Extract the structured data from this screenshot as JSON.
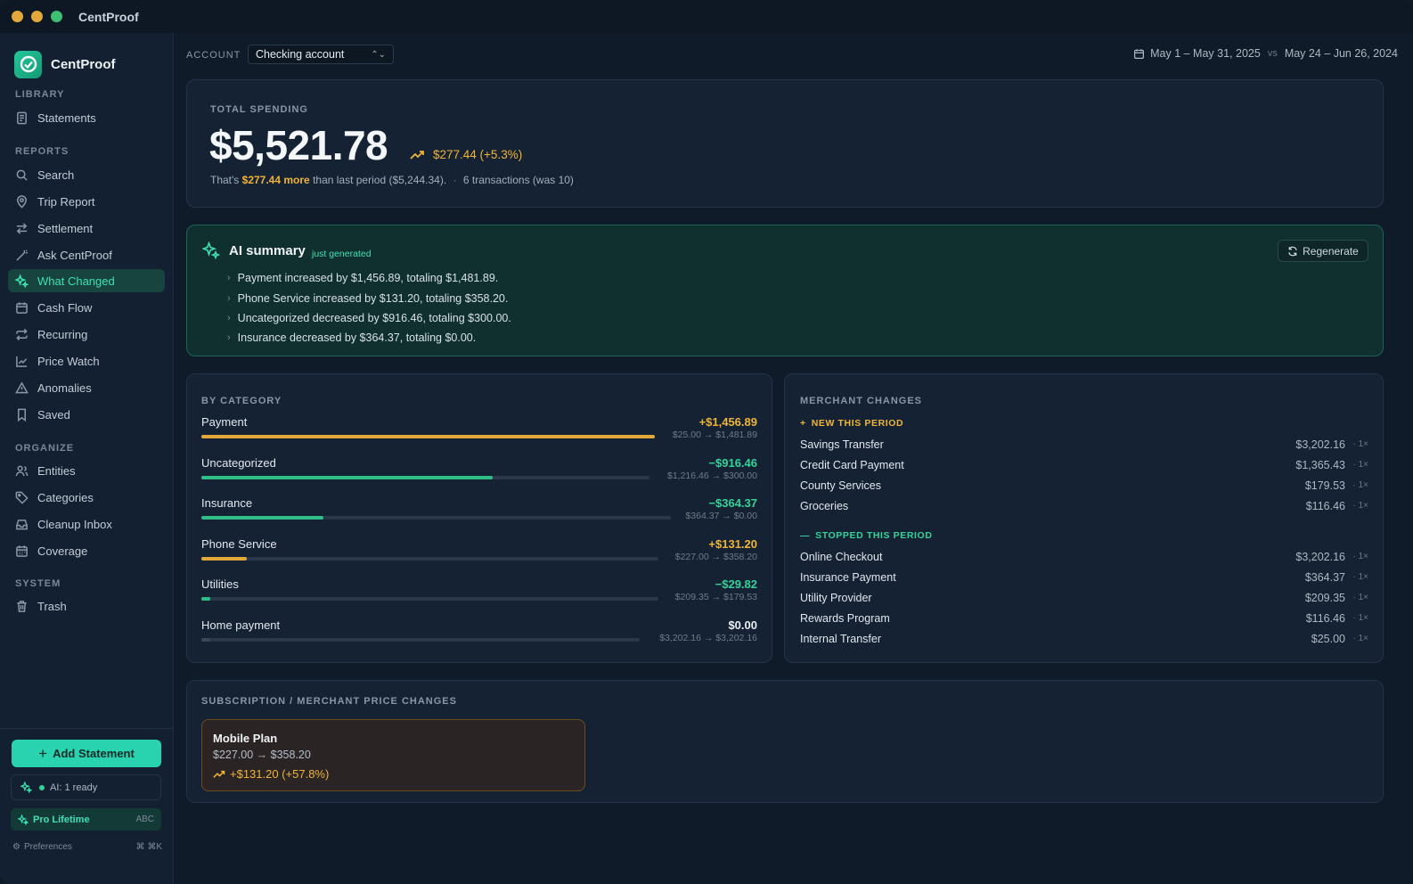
{
  "window": {
    "title": "CentProof"
  },
  "brand": {
    "name": "CentProof"
  },
  "sidebar": {
    "sections": [
      {
        "label": "LIBRARY",
        "items": [
          {
            "label": "Statements",
            "icon": "document-icon"
          }
        ]
      },
      {
        "label": "REPORTS",
        "items": [
          {
            "label": "Search",
            "icon": "search-icon"
          },
          {
            "label": "Trip Report",
            "icon": "map-pin-icon"
          },
          {
            "label": "Settlement",
            "icon": "arrows-icon"
          },
          {
            "label": "Ask CentProof",
            "icon": "wand-icon"
          },
          {
            "label": "What Changed",
            "icon": "sparkle-icon",
            "active": true
          },
          {
            "label": "Cash Flow",
            "icon": "calendar-icon"
          },
          {
            "label": "Recurring",
            "icon": "repeat-icon"
          },
          {
            "label": "Price Watch",
            "icon": "line-chart-icon"
          },
          {
            "label": "Anomalies",
            "icon": "warning-icon"
          },
          {
            "label": "Saved",
            "icon": "bookmark-icon"
          }
        ]
      },
      {
        "label": "ORGANIZE",
        "items": [
          {
            "label": "Entities",
            "icon": "users-icon"
          },
          {
            "label": "Categories",
            "icon": "tag-icon"
          },
          {
            "label": "Cleanup Inbox",
            "icon": "inbox-icon"
          },
          {
            "label": "Coverage",
            "icon": "calendar-grid-icon"
          }
        ]
      },
      {
        "label": "SYSTEM",
        "items": [
          {
            "label": "Trash",
            "icon": "trash-icon"
          }
        ]
      }
    ],
    "add_button": "Add Statement",
    "ai_status": "AI: 1 ready",
    "pro_label": "Pro Lifetime",
    "pro_tag": "ABC",
    "preferences": "Preferences",
    "preferences_shortcut": "⌘ ⌘K"
  },
  "header": {
    "account_label": "ACCOUNT",
    "account_value": "Checking account",
    "period_current": "May 1 – May 31, 2025",
    "vs": "vs",
    "period_previous": "May 24 – Jun 26, 2024"
  },
  "total": {
    "label": "TOTAL SPENDING",
    "amount": "$5,521.78",
    "delta": "$277.44 (+5.3%)",
    "sub_prefix": "That's",
    "sub_highlight": "$277.44 more",
    "sub_rest": "than last period ($5,244.34).",
    "sub_dot": "·",
    "sub_tx": "6 transactions (was 10)"
  },
  "ai_summary": {
    "title": "AI summary",
    "badge": "just generated",
    "regenerate": "Regenerate",
    "bullets": [
      "Payment increased by $1,456.89, totaling $1,481.89.",
      "Phone Service increased by $131.20, totaling $358.20.",
      "Uncategorized decreased by $916.46, totaling $300.00.",
      "Insurance decreased by $364.37, totaling $0.00."
    ]
  },
  "by_category": {
    "label": "BY CATEGORY",
    "rows": [
      {
        "name": "Payment",
        "delta": "+$1,456.89",
        "range": "$25.00 → $1,481.89",
        "direction": "up",
        "fill": 1.0
      },
      {
        "name": "Uncategorized",
        "delta": "−$916.46",
        "range": "$1,216.46 → $300.00",
        "direction": "down",
        "fill": 0.65
      },
      {
        "name": "Insurance",
        "delta": "−$364.37",
        "range": "$364.37 → $0.00",
        "direction": "down",
        "fill": 0.26
      },
      {
        "name": "Phone Service",
        "delta": "+$131.20",
        "range": "$227.00 → $358.20",
        "direction": "up",
        "fill": 0.1
      },
      {
        "name": "Utilities",
        "delta": "−$29.82",
        "range": "$209.35 → $179.53",
        "direction": "down",
        "fill": 0.02
      },
      {
        "name": "Home payment",
        "delta": "$0.00",
        "range": "$3,202.16 → $3,202.16",
        "direction": "neutral",
        "fill": 0.02
      }
    ]
  },
  "merchant_changes": {
    "label": "MERCHANT CHANGES",
    "new_label": "NEW THIS PERIOD",
    "stopped_label": "STOPPED THIS PERIOD",
    "new": [
      {
        "name": "Savings Transfer",
        "amount": "$3,202.16",
        "count": "· 1×"
      },
      {
        "name": "Credit Card Payment",
        "amount": "$1,365.43",
        "count": "· 1×"
      },
      {
        "name": "County Services",
        "amount": "$179.53",
        "count": "· 1×"
      },
      {
        "name": "Groceries",
        "amount": "$116.46",
        "count": "· 1×"
      }
    ],
    "stopped": [
      {
        "name": "Online Checkout",
        "amount": "$3,202.16",
        "count": "· 1×"
      },
      {
        "name": "Insurance Payment",
        "amount": "$364.37",
        "count": "· 1×"
      },
      {
        "name": "Utility Provider",
        "amount": "$209.35",
        "count": "· 1×"
      },
      {
        "name": "Rewards Program",
        "amount": "$116.46",
        "count": "· 1×"
      },
      {
        "name": "Internal Transfer",
        "amount": "$25.00",
        "count": "· 1×"
      }
    ]
  },
  "price_changes": {
    "label": "SUBSCRIPTION / MERCHANT PRICE CHANGES",
    "items": [
      {
        "name": "Mobile Plan",
        "range": "$227.00 → $358.20",
        "delta": "+$131.20 (+57.8%)"
      }
    ]
  },
  "colors": {
    "accent": "#2ad3b0",
    "increase": "#f0b43a",
    "decrease": "#34d399"
  }
}
